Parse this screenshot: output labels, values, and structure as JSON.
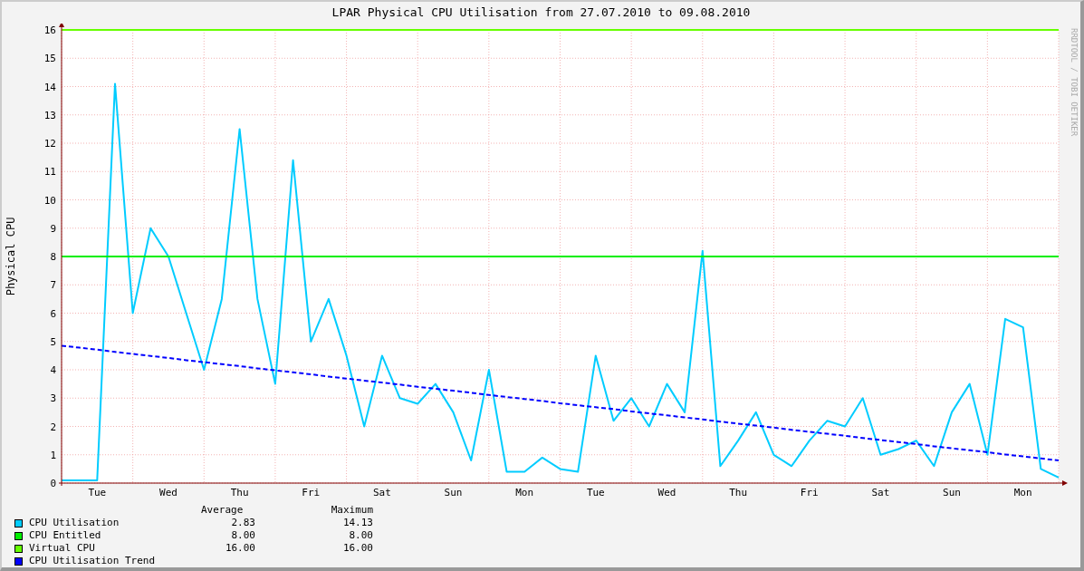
{
  "title": "LPAR Physical CPU Utilisation from 27.07.2010 to 09.08.2010",
  "side_label": "RRDTOOL / TOBI OETIKER",
  "chart_data": {
    "type": "line",
    "ylabel": "Physical CPU",
    "ylim": [
      0,
      16
    ],
    "grid": true,
    "yticks": [
      0,
      1,
      2,
      3,
      4,
      5,
      6,
      7,
      8,
      9,
      10,
      11,
      12,
      13,
      14,
      15,
      16
    ],
    "categories": [
      null,
      null,
      "Tue",
      null,
      null,
      null,
      "Wed",
      null,
      null,
      null,
      "Thu",
      null,
      null,
      null,
      "Fri",
      null,
      null,
      null,
      "Sat",
      null,
      null,
      null,
      "Sun",
      null,
      null,
      null,
      "Mon",
      null,
      null,
      null,
      "Tue",
      null,
      null,
      null,
      "Wed",
      null,
      null,
      null,
      "Thu",
      null,
      null,
      null,
      "Fri",
      null,
      null,
      null,
      "Sat",
      null,
      null,
      null,
      "Sun",
      null,
      null,
      null,
      "Mon",
      null,
      null
    ],
    "series": [
      {
        "name": "CPU Utilisation",
        "color": "#00ccff",
        "values": [
          0.1,
          0.1,
          0.1,
          14.1,
          6.0,
          9.0,
          8.0,
          6.0,
          4.0,
          6.5,
          12.5,
          6.5,
          3.5,
          11.4,
          5.0,
          6.5,
          4.5,
          2.0,
          4.5,
          3.0,
          2.8,
          3.5,
          2.5,
          0.8,
          4.0,
          0.4,
          0.4,
          0.9,
          0.5,
          0.4,
          4.5,
          2.2,
          3.0,
          2.0,
          3.5,
          2.5,
          8.2,
          0.6,
          1.5,
          2.5,
          1.0,
          0.6,
          1.5,
          2.2,
          2.0,
          3.0,
          1.0,
          1.2,
          1.5,
          0.6,
          2.5,
          3.5,
          1.0,
          5.8,
          5.5,
          0.5,
          0.2
        ]
      },
      {
        "name": "CPU Entitled",
        "color": "#00ee00",
        "values": [
          8,
          8,
          8,
          8,
          8,
          8,
          8,
          8,
          8,
          8,
          8,
          8,
          8,
          8,
          8,
          8,
          8,
          8,
          8,
          8,
          8,
          8,
          8,
          8,
          8,
          8,
          8,
          8,
          8,
          8,
          8,
          8,
          8,
          8,
          8,
          8,
          8,
          8,
          8,
          8,
          8,
          8,
          8,
          8,
          8,
          8,
          8,
          8,
          8,
          8,
          8,
          8,
          8,
          8,
          8,
          8,
          8
        ]
      },
      {
        "name": "Virtual CPU",
        "color": "#66ff00",
        "values": [
          16,
          16,
          16,
          16,
          16,
          16,
          16,
          16,
          16,
          16,
          16,
          16,
          16,
          16,
          16,
          16,
          16,
          16,
          16,
          16,
          16,
          16,
          16,
          16,
          16,
          16,
          16,
          16,
          16,
          16,
          16,
          16,
          16,
          16,
          16,
          16,
          16,
          16,
          16,
          16,
          16,
          16,
          16,
          16,
          16,
          16,
          16,
          16,
          16,
          16,
          16,
          16,
          16,
          16,
          16,
          16,
          16
        ]
      },
      {
        "name": "CPU Utilisation Trend",
        "color": "#0000ff",
        "line_style": "dashed",
        "values": [
          4.85,
          4.78,
          4.71,
          4.63,
          4.56,
          4.49,
          4.42,
          4.34,
          4.27,
          4.2,
          4.13,
          4.05,
          3.98,
          3.91,
          3.84,
          3.76,
          3.69,
          3.62,
          3.55,
          3.48,
          3.4,
          3.33,
          3.26,
          3.19,
          3.11,
          3.04,
          2.97,
          2.9,
          2.82,
          2.75,
          2.68,
          2.61,
          2.53,
          2.46,
          2.39,
          2.32,
          2.25,
          2.17,
          2.1,
          2.03,
          1.96,
          1.88,
          1.81,
          1.74,
          1.67,
          1.59,
          1.52,
          1.45,
          1.38,
          1.3,
          1.23,
          1.16,
          1.09,
          1.01,
          0.94,
          0.87,
          0.8
        ]
      }
    ]
  },
  "legend": {
    "columns": [
      "Average",
      "Maximum"
    ],
    "stats": [
      {
        "average": "2.83",
        "maximum": "14.13"
      },
      {
        "average": "8.00",
        "maximum": "8.00"
      },
      {
        "average": "16.00",
        "maximum": "16.00"
      }
    ]
  }
}
